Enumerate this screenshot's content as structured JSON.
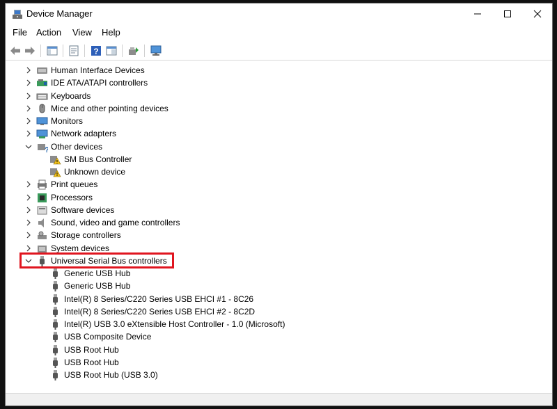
{
  "window": {
    "title": "Device Manager",
    "icons": {
      "app": "device-manager-icon",
      "minimize": "minimize-icon",
      "maximize": "maximize-icon",
      "close": "close-icon"
    }
  },
  "menu": [
    "File",
    "Action",
    "View",
    "Help"
  ],
  "toolbar": {
    "buttons": [
      "back-arrow-icon",
      "forward-arrow-icon",
      "show-hide-console-tree-icon",
      "properties-icon",
      "help-icon",
      "update-driver-icon",
      "scan-hardware-icon",
      "display-devices-icon"
    ]
  },
  "tree": {
    "categories": [
      {
        "label": "Human Interface Devices",
        "expanded": false,
        "icon": "hid-icon"
      },
      {
        "label": "IDE ATA/ATAPI controllers",
        "expanded": false,
        "icon": "ide-controller-icon"
      },
      {
        "label": "Keyboards",
        "expanded": false,
        "icon": "keyboard-icon"
      },
      {
        "label": "Mice and other pointing devices",
        "expanded": false,
        "icon": "mouse-icon"
      },
      {
        "label": "Monitors",
        "expanded": false,
        "icon": "monitor-icon"
      },
      {
        "label": "Network adapters",
        "expanded": false,
        "icon": "network-adapter-icon"
      },
      {
        "label": "Other devices",
        "expanded": true,
        "icon": "other-devices-icon",
        "children": [
          {
            "label": "SM Bus Controller",
            "icon": "warning-device-icon"
          },
          {
            "label": "Unknown device",
            "icon": "warning-device-icon"
          }
        ]
      },
      {
        "label": "Print queues",
        "expanded": false,
        "icon": "printer-icon"
      },
      {
        "label": "Processors",
        "expanded": false,
        "icon": "processor-icon"
      },
      {
        "label": "Software devices",
        "expanded": false,
        "icon": "software-device-icon"
      },
      {
        "label": "Sound, video and game controllers",
        "expanded": false,
        "icon": "speaker-icon"
      },
      {
        "label": "Storage controllers",
        "expanded": false,
        "icon": "storage-controller-icon"
      },
      {
        "label": "System devices",
        "expanded": false,
        "icon": "system-devices-icon"
      },
      {
        "label": "Universal Serial Bus controllers",
        "expanded": true,
        "highlighted": true,
        "icon": "usb-icon",
        "children": [
          {
            "label": "Generic USB Hub",
            "icon": "usb-device-icon"
          },
          {
            "label": "Generic USB Hub",
            "icon": "usb-device-icon"
          },
          {
            "label": "Intel(R) 8 Series/C220 Series USB EHCI #1 - 8C26",
            "icon": "usb-device-icon"
          },
          {
            "label": "Intel(R) 8 Series/C220 Series USB EHCI #2 - 8C2D",
            "icon": "usb-device-icon"
          },
          {
            "label": "Intel(R) USB 3.0 eXtensible Host Controller - 1.0 (Microsoft)",
            "icon": "usb-device-icon"
          },
          {
            "label": "USB Composite Device",
            "icon": "usb-device-icon"
          },
          {
            "label": "USB Root Hub",
            "icon": "usb-device-icon"
          },
          {
            "label": "USB Root Hub",
            "icon": "usb-device-icon"
          },
          {
            "label": "USB Root Hub (USB 3.0)",
            "icon": "usb-device-icon"
          }
        ]
      }
    ]
  },
  "colors": {
    "highlight_border": "#e0151f",
    "window_bg": "#ffffff",
    "backdrop": "#111111"
  }
}
